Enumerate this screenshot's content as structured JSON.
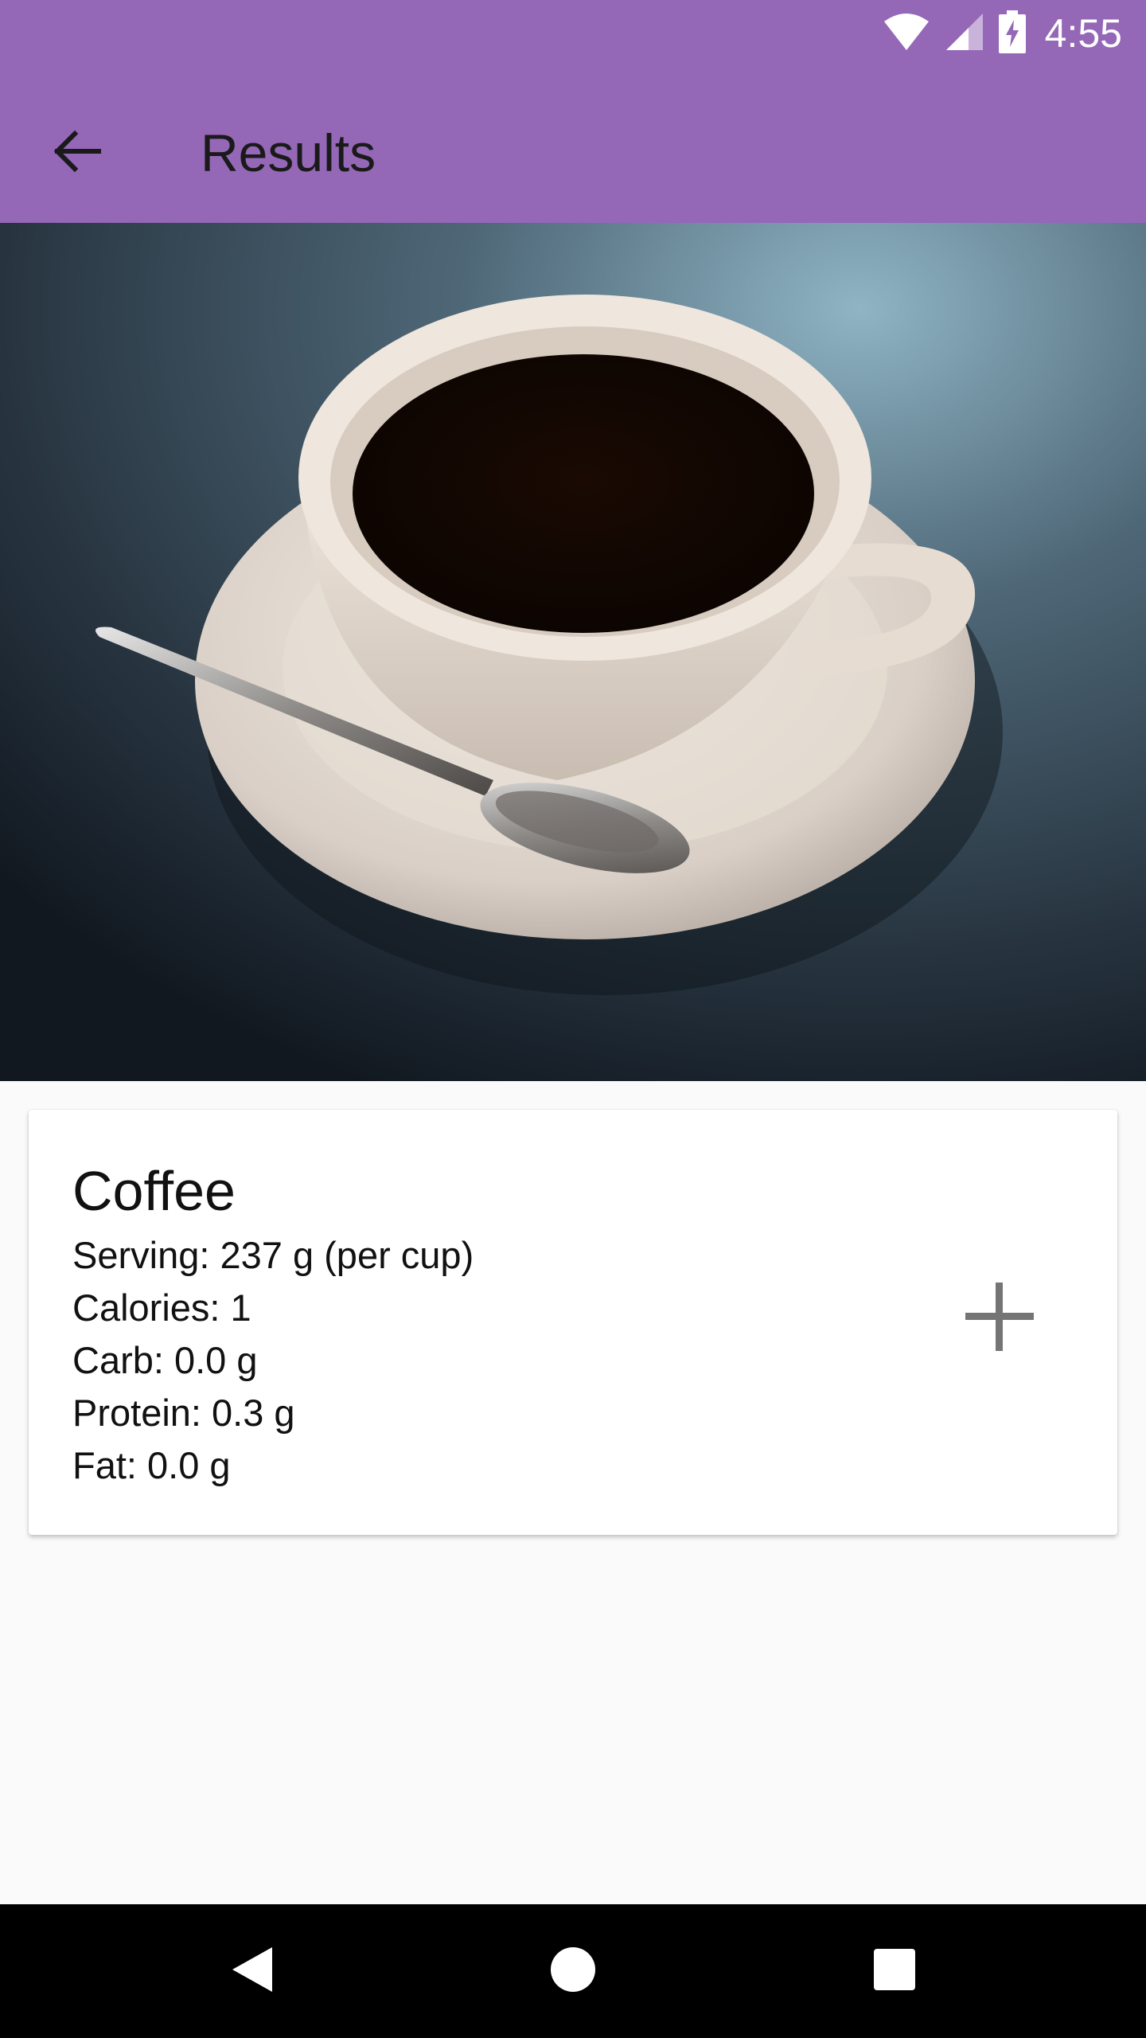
{
  "status_bar": {
    "time": "4:55",
    "icons": [
      "wifi-icon",
      "cell-signal-icon",
      "battery-charging-icon"
    ]
  },
  "app_bar": {
    "back_icon": "arrow-back-icon",
    "title": "Results"
  },
  "photo": {
    "subject": "coffee-cup-photo"
  },
  "result_card": {
    "name": "Coffee",
    "serving": "Serving: 237 g (per cup)",
    "calories": "Calories: 1",
    "carb": "Carb: 0.0 g",
    "protein": "Protein: 0.3 g",
    "fat": "Fat: 0.0 g",
    "add_icon": "plus-icon"
  },
  "nav_bar": {
    "icons": [
      "nav-back-icon",
      "nav-home-icon",
      "nav-recents-icon"
    ]
  },
  "colors": {
    "app_bar": "#9467b7",
    "background": "#fafafa",
    "nav_bar": "#000000"
  }
}
